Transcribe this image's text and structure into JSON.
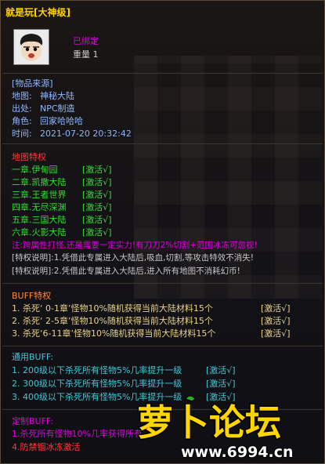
{
  "header": {
    "title": "就是玩[大神级]",
    "bound": "已绑定",
    "weight": "重量 1"
  },
  "source": {
    "heading": "[物品来源]",
    "rows": [
      {
        "label": "地图:",
        "value": "神秘大陆"
      },
      {
        "label": "出处:",
        "value": "NPC制造"
      },
      {
        "label": "角色:",
        "value": "回家哈哈哈"
      },
      {
        "label": "时间:",
        "value": "2021-07-20 20:32:42"
      }
    ]
  },
  "map_traits": {
    "heading": "地图特权",
    "items": [
      {
        "name": "一章.伊甸园",
        "status": "[激活√]"
      },
      {
        "name": "二章.凯撒大陆",
        "status": "[激活√]"
      },
      {
        "name": "三章.王者世界",
        "status": "[激活√]"
      },
      {
        "name": "四章.无尽深渊",
        "status": "[激活√]"
      },
      {
        "name": "五章.三国大陆",
        "status": "[激活√]"
      },
      {
        "name": "六章.火影大陆",
        "status": "[激活√]"
      }
    ],
    "note": "注:跨属性打怪,还是需要一定实力!有刀刀2%切割+范围冰冻可忽视!",
    "desc1": "[特权说明]:1.凭借此专属进入大陆后,吸血,切割,等攻击特效不消失!",
    "desc2": "[特权说明]:2.凭借此专属进入大陆后,进入所有地图不消耗幻币!"
  },
  "buff_traits": {
    "heading": "BUFF特权",
    "items": [
      {
        "text": "1. 杀死‘ 0-1章’怪物10%随机获得当前大陆材料15个",
        "status": "[激活√]"
      },
      {
        "text": "2. 杀死‘ 2-5章’怪物10%随机获得当前大陆材料15个",
        "status": "[激活√]"
      },
      {
        "text": "3. 杀死‘6-11章’怪物10%随机获得当前大陆材料15个",
        "status": "[激活√]"
      }
    ]
  },
  "common_buff": {
    "heading": "通用BUFF:",
    "items": [
      {
        "text": "1. 200级以下杀死所有怪物5%几率提升一级",
        "status": "[激活√]"
      },
      {
        "text": "2. 300级以下杀死所有怪物5%几率提升一级",
        "status": "[激活√]"
      },
      {
        "text": "3. 400级以下杀死所有怪物5%几率提升一级",
        "status": "[激活√]"
      }
    ]
  },
  "custom_buff": {
    "heading": "定制BUFF:",
    "line1": "1.杀死所有怪物10%几率获得所有",
    "line2": "4.防禁锢冰冻激活"
  },
  "watermark": {
    "brand": "萝卜论坛",
    "url": "www.6994.cn"
  }
}
